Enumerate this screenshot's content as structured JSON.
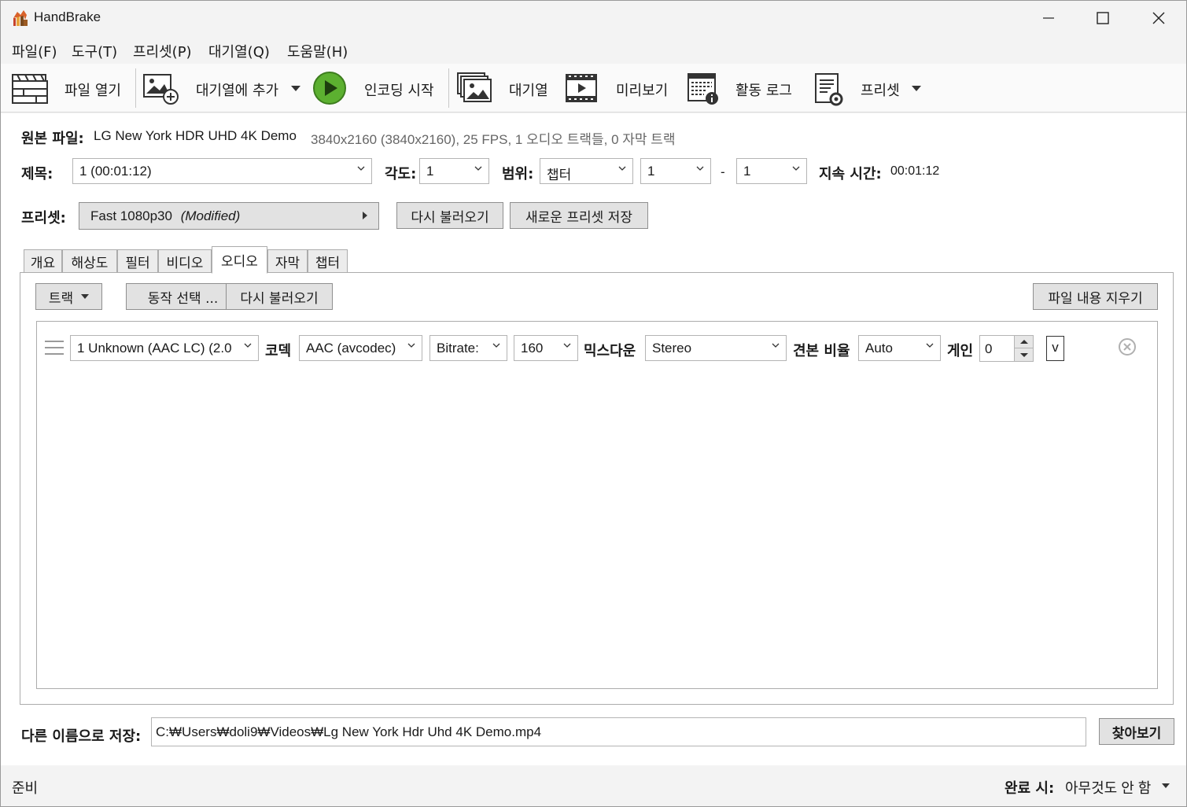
{
  "window": {
    "title": "HandBrake"
  },
  "menu": [
    "파일(F)",
    "도구(T)",
    "프리셋(P)",
    "대기열(Q)",
    "도움말(H)"
  ],
  "toolbar": {
    "open": "파일 열기",
    "add_queue": "대기열에 추가",
    "start": "인코딩 시작",
    "queue": "대기열",
    "preview": "미리보기",
    "activity_log": "활동 로그",
    "presets": "프리셋"
  },
  "source": {
    "label": "원본 파일:",
    "name": "LG New York HDR UHD 4K Demo",
    "info": "3840x2160 (3840x2160), 25 FPS, 1 오디오 트랙들, 0 자막 트랙"
  },
  "title_row": {
    "title_label": "제목:",
    "title_value": "1  (00:01:12)",
    "angle_label": "각도:",
    "angle_value": "1",
    "range_label": "범위:",
    "range_type": "챕터",
    "range_start": "1",
    "range_dash": "-",
    "range_end": "1",
    "duration_label": "지속 시간:",
    "duration_value": "00:01:12"
  },
  "preset_row": {
    "label": "프리셋:",
    "name": "Fast 1080p30",
    "modified": "(Modified)",
    "reload": "다시 불러오기",
    "save_new": "새로운 프리셋 저장"
  },
  "tabs": [
    "개요",
    "해상도",
    "필터",
    "비디오",
    "오디오",
    "자막",
    "챕터"
  ],
  "active_tab": "오디오",
  "audio": {
    "tracks_btn": "트랙",
    "behavior_btn": "동작 선택 ...",
    "reload_btn": "다시 불러오기",
    "clear_btn": "파일 내용 지우기",
    "track": {
      "source": "1 Unknown (AAC LC) (2.0",
      "codec_label": "코덱",
      "codec": "AAC (avcodec)",
      "rate_mode": "Bitrate:",
      "bitrate": "160",
      "mixdown_label": "믹스다운",
      "mixdown": "Stereo",
      "samplerate_label": "견본 비율",
      "samplerate": "Auto",
      "gain_label": "게인",
      "gain": "0",
      "expand": "v"
    }
  },
  "save_as": {
    "label": "다른 이름으로 저장:",
    "path": "C:₩Users₩doli9₩Videos₩Lg New York Hdr Uhd 4K Demo.mp4",
    "browse": "찾아보기"
  },
  "status": {
    "text": "준비",
    "when_done_label": "완료 시:",
    "when_done_value": "아무것도 안 함"
  },
  "colors": {
    "start_green": "#5cb030",
    "accent": "#0078d4"
  }
}
